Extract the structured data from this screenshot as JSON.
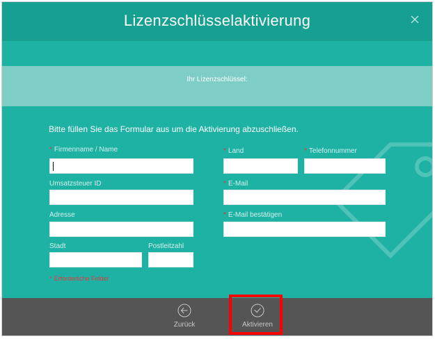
{
  "window": {
    "title": "Lizenzschlüsselaktivierung"
  },
  "license": {
    "label": "Ihr Lizenzschlüssel:"
  },
  "form": {
    "instruction": "Bitte füllen Sie das Formular aus um die Aktivierung abzuschließen.",
    "required_mark": "*",
    "company_label": "Firmenname / Name",
    "company_value": "",
    "vat_label": "Umsatzsteuer ID",
    "vat_value": "",
    "address_label": "Adresse",
    "address_value": "",
    "city_label": "Stadt",
    "city_value": "",
    "zip_label": "Postleitzahl",
    "zip_value": "",
    "country_label": "Land",
    "country_value": "",
    "phone_label": "Telefonnummer",
    "phone_value": "",
    "email_label": "E-Mail",
    "email_value": "",
    "email_confirm_label": "E-Mail bestätigen",
    "email_confirm_value": "",
    "required_note": "Erforderliche Felder"
  },
  "footer": {
    "back_label": "Zurück",
    "activate_label": "Aktivieren"
  },
  "colors": {
    "teal": "#1db2a4",
    "title_bar": "#16a091",
    "key_bar": "#7fcec6",
    "footer": "#555555",
    "required": "#e23b3b",
    "highlight": "#ff0000"
  },
  "icons": {
    "close": "close-icon",
    "back": "arrow-left-circle-icon",
    "activate": "check-circle-icon"
  }
}
